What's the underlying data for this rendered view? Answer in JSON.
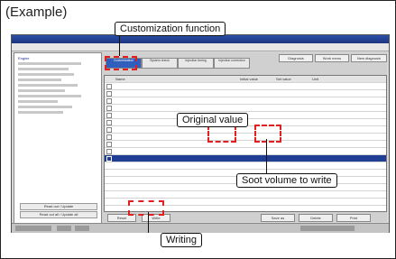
{
  "example_label": "(Example)",
  "callouts": {
    "customization": "Customization function",
    "original": "Original value",
    "soot": "Soot volume to write",
    "writing": "Writing"
  },
  "app": {
    "left_pane": {
      "root": "Engine",
      "buttons": [
        "Read out / Update",
        "Read out all / Update all"
      ]
    },
    "tabs": [
      "Customization",
      "System check",
      "Injection timing",
      "Injection correction"
    ],
    "top_buttons": [
      "Diagnosis",
      "Work menu",
      "New diagnosis"
    ],
    "table_headers": [
      "Name",
      "Initial value",
      "Set value",
      "Unit"
    ],
    "rows": 19,
    "bottom_buttons": [
      "Reset",
      "Write",
      "Save as",
      "Delete",
      "Print"
    ]
  },
  "colors": {
    "highlight": "#e02020",
    "selected_row": "#1f3e94",
    "tab_active": "#2f5ebd"
  }
}
